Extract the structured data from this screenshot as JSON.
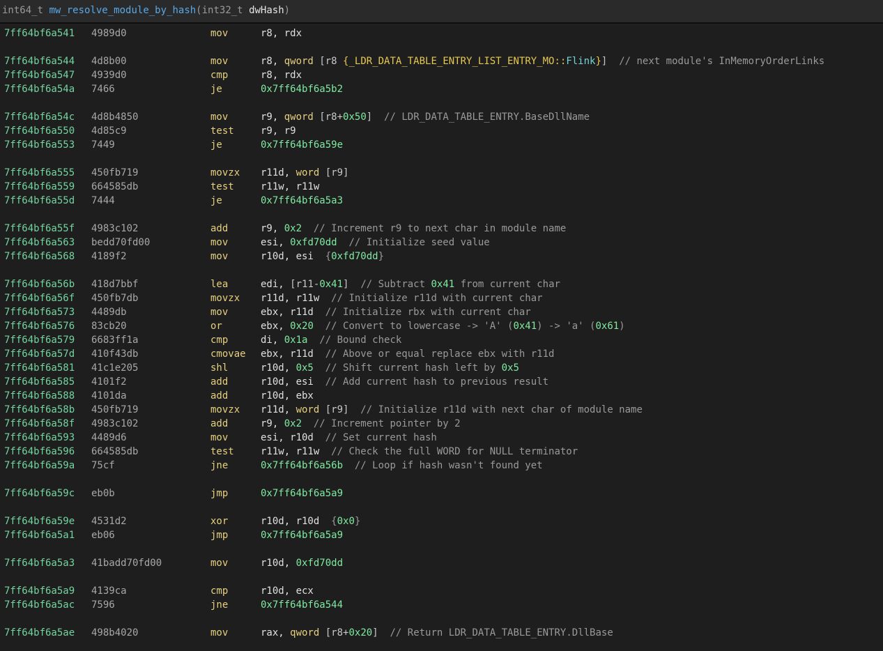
{
  "header": {
    "return_type": "int64_t",
    "function_name": "mw_resolve_module_by_hash",
    "param_type": "int32_t",
    "param_name": "dwHash",
    "open_paren": "(",
    "close_paren": ")"
  },
  "instructions": [
    {
      "addr": "7ff64bf6a541",
      "bytes": "4989d0",
      "mnem": "mov",
      "ops": [
        {
          "t": "reg",
          "v": "r8, rdx"
        }
      ]
    },
    {
      "addr": "7ff64bf6a544",
      "bytes": "4d8b00",
      "mnem": "mov",
      "ops": [
        {
          "t": "reg",
          "v": "r8, "
        },
        {
          "t": "kw",
          "v": "qword"
        },
        {
          "t": "brk",
          "v": " [r8 "
        },
        {
          "t": "fld",
          "v": "{_LDR_DATA_TABLE_ENTRY_LIST_ENTRY_MO::"
        },
        {
          "t": "fld2",
          "v": "Flink"
        },
        {
          "t": "fld",
          "v": "}"
        },
        {
          "t": "brk",
          "v": "]"
        },
        {
          "t": "cmt",
          "v": "  // next module's InMemoryOrderLinks"
        }
      ]
    },
    {
      "addr": "7ff64bf6a547",
      "bytes": "4939d0",
      "mnem": "cmp",
      "ops": [
        {
          "t": "reg",
          "v": "r8, rdx"
        }
      ]
    },
    {
      "addr": "7ff64bf6a54a",
      "bytes": "7466",
      "mnem": "je",
      "ops": [
        {
          "t": "num",
          "v": "0x7ff64bf6a5b2"
        }
      ]
    },
    {
      "addr": "7ff64bf6a54c",
      "bytes": "4d8b4850",
      "mnem": "mov",
      "ops": [
        {
          "t": "reg",
          "v": "r9, "
        },
        {
          "t": "kw",
          "v": "qword"
        },
        {
          "t": "brk",
          "v": " [r8+"
        },
        {
          "t": "num",
          "v": "0x50"
        },
        {
          "t": "brk",
          "v": "]"
        },
        {
          "t": "cmt",
          "v": "  // LDR_DATA_TABLE_ENTRY.BaseDllName"
        }
      ]
    },
    {
      "addr": "7ff64bf6a550",
      "bytes": "4d85c9",
      "mnem": "test",
      "ops": [
        {
          "t": "reg",
          "v": "r9, r9"
        }
      ]
    },
    {
      "addr": "7ff64bf6a553",
      "bytes": "7449",
      "mnem": "je",
      "ops": [
        {
          "t": "num",
          "v": "0x7ff64bf6a59e"
        }
      ]
    },
    {
      "addr": "7ff64bf6a555",
      "bytes": "450fb719",
      "mnem": "movzx",
      "ops": [
        {
          "t": "reg",
          "v": "r11d, "
        },
        {
          "t": "kw",
          "v": "word"
        },
        {
          "t": "brk",
          "v": " [r9]"
        }
      ]
    },
    {
      "addr": "7ff64bf6a559",
      "bytes": "664585db",
      "mnem": "test",
      "ops": [
        {
          "t": "reg",
          "v": "r11w, r11w"
        }
      ]
    },
    {
      "addr": "7ff64bf6a55d",
      "bytes": "7444",
      "mnem": "je",
      "ops": [
        {
          "t": "num",
          "v": "0x7ff64bf6a5a3"
        }
      ]
    },
    {
      "addr": "7ff64bf6a55f",
      "bytes": "4983c102",
      "mnem": "add",
      "ops": [
        {
          "t": "reg",
          "v": "r9, "
        },
        {
          "t": "num",
          "v": "0x2"
        },
        {
          "t": "cmt",
          "v": "  // Increment r9 to next char in module name"
        }
      ]
    },
    {
      "addr": "7ff64bf6a563",
      "bytes": "bedd70fd00",
      "mnem": "mov",
      "ops": [
        {
          "t": "reg",
          "v": "esi, "
        },
        {
          "t": "num",
          "v": "0xfd70dd"
        },
        {
          "t": "cmt",
          "v": "  // Initialize seed value"
        }
      ]
    },
    {
      "addr": "7ff64bf6a568",
      "bytes": "4189f2",
      "mnem": "mov",
      "ops": [
        {
          "t": "reg",
          "v": "r10d, esi  "
        },
        {
          "t": "cmt",
          "v": "{"
        },
        {
          "t": "num",
          "v": "0xfd70dd"
        },
        {
          "t": "cmt",
          "v": "}"
        }
      ]
    },
    {
      "addr": "7ff64bf6a56b",
      "bytes": "418d7bbf",
      "mnem": "lea",
      "ops": [
        {
          "t": "reg",
          "v": "edi, "
        },
        {
          "t": "brk",
          "v": "[r11-"
        },
        {
          "t": "num",
          "v": "0x41"
        },
        {
          "t": "brk",
          "v": "]"
        },
        {
          "t": "cmt",
          "v": "  // Subtract "
        },
        {
          "t": "num",
          "v": "0x41"
        },
        {
          "t": "cmt",
          "v": " from current char"
        }
      ]
    },
    {
      "addr": "7ff64bf6a56f",
      "bytes": "450fb7db",
      "mnem": "movzx",
      "ops": [
        {
          "t": "reg",
          "v": "r11d, r11w"
        },
        {
          "t": "cmt",
          "v": "  // Initialize r11d with current char"
        }
      ]
    },
    {
      "addr": "7ff64bf6a573",
      "bytes": "4489db",
      "mnem": "mov",
      "ops": [
        {
          "t": "reg",
          "v": "ebx, r11d"
        },
        {
          "t": "cmt",
          "v": "  // Initialize rbx with current char"
        }
      ]
    },
    {
      "addr": "7ff64bf6a576",
      "bytes": "83cb20",
      "mnem": "or",
      "ops": [
        {
          "t": "reg",
          "v": "ebx, "
        },
        {
          "t": "num",
          "v": "0x20"
        },
        {
          "t": "cmt",
          "v": "  // Convert to lowercase -> 'A' ("
        },
        {
          "t": "num",
          "v": "0x41"
        },
        {
          "t": "cmt",
          "v": ") -> 'a' ("
        },
        {
          "t": "num",
          "v": "0x61"
        },
        {
          "t": "cmt",
          "v": ")"
        }
      ]
    },
    {
      "addr": "7ff64bf6a579",
      "bytes": "6683ff1a",
      "mnem": "cmp",
      "ops": [
        {
          "t": "reg",
          "v": "di, "
        },
        {
          "t": "num",
          "v": "0x1a"
        },
        {
          "t": "cmt",
          "v": "  // Bound check"
        }
      ]
    },
    {
      "addr": "7ff64bf6a57d",
      "bytes": "410f43db",
      "mnem": "cmovae",
      "ops": [
        {
          "t": "reg",
          "v": "ebx, r11d"
        },
        {
          "t": "cmt",
          "v": "  // Above or equal replace ebx with r11d"
        }
      ]
    },
    {
      "addr": "7ff64bf6a581",
      "bytes": "41c1e205",
      "mnem": "shl",
      "ops": [
        {
          "t": "reg",
          "v": "r10d, "
        },
        {
          "t": "num",
          "v": "0x5"
        },
        {
          "t": "cmt",
          "v": "  // Shift current hash left by "
        },
        {
          "t": "num",
          "v": "0x5"
        }
      ]
    },
    {
      "addr": "7ff64bf6a585",
      "bytes": "4101f2",
      "mnem": "add",
      "ops": [
        {
          "t": "reg",
          "v": "r10d, esi"
        },
        {
          "t": "cmt",
          "v": "  // Add current hash to previous result"
        }
      ]
    },
    {
      "addr": "7ff64bf6a588",
      "bytes": "4101da",
      "mnem": "add",
      "ops": [
        {
          "t": "reg",
          "v": "r10d, ebx"
        }
      ]
    },
    {
      "addr": "7ff64bf6a58b",
      "bytes": "450fb719",
      "mnem": "movzx",
      "ops": [
        {
          "t": "reg",
          "v": "r11d, "
        },
        {
          "t": "kw",
          "v": "word"
        },
        {
          "t": "brk",
          "v": " [r9]"
        },
        {
          "t": "cmt",
          "v": "  // Initialize r11d with next char of module name"
        }
      ]
    },
    {
      "addr": "7ff64bf6a58f",
      "bytes": "4983c102",
      "mnem": "add",
      "ops": [
        {
          "t": "reg",
          "v": "r9, "
        },
        {
          "t": "num",
          "v": "0x2"
        },
        {
          "t": "cmt",
          "v": "  // Increment pointer by 2"
        }
      ]
    },
    {
      "addr": "7ff64bf6a593",
      "bytes": "4489d6",
      "mnem": "mov",
      "ops": [
        {
          "t": "reg",
          "v": "esi, r10d"
        },
        {
          "t": "cmt",
          "v": "  // Set current hash"
        }
      ]
    },
    {
      "addr": "7ff64bf6a596",
      "bytes": "664585db",
      "mnem": "test",
      "ops": [
        {
          "t": "reg",
          "v": "r11w, r11w"
        },
        {
          "t": "cmt",
          "v": "  // Check the full WORD for NULL terminator"
        }
      ]
    },
    {
      "addr": "7ff64bf6a59a",
      "bytes": "75cf",
      "mnem": "jne",
      "ops": [
        {
          "t": "num",
          "v": "0x7ff64bf6a56b"
        },
        {
          "t": "cmt",
          "v": "  // Loop if hash wasn't found yet"
        }
      ]
    },
    {
      "addr": "7ff64bf6a59c",
      "bytes": "eb0b",
      "mnem": "jmp",
      "ops": [
        {
          "t": "num",
          "v": "0x7ff64bf6a5a9"
        }
      ]
    },
    {
      "addr": "7ff64bf6a59e",
      "bytes": "4531d2",
      "mnem": "xor",
      "ops": [
        {
          "t": "reg",
          "v": "r10d, r10d  "
        },
        {
          "t": "cmt",
          "v": "{"
        },
        {
          "t": "num",
          "v": "0x0"
        },
        {
          "t": "cmt",
          "v": "}"
        }
      ]
    },
    {
      "addr": "7ff64bf6a5a1",
      "bytes": "eb06",
      "mnem": "jmp",
      "ops": [
        {
          "t": "num",
          "v": "0x7ff64bf6a5a9"
        }
      ]
    },
    {
      "addr": "7ff64bf6a5a3",
      "bytes": "41badd70fd00",
      "mnem": "mov",
      "ops": [
        {
          "t": "reg",
          "v": "r10d, "
        },
        {
          "t": "num",
          "v": "0xfd70dd"
        }
      ]
    },
    {
      "addr": "7ff64bf6a5a9",
      "bytes": "4139ca",
      "mnem": "cmp",
      "ops": [
        {
          "t": "reg",
          "v": "r10d, ecx"
        }
      ]
    },
    {
      "addr": "7ff64bf6a5ac",
      "bytes": "7596",
      "mnem": "jne",
      "ops": [
        {
          "t": "num",
          "v": "0x7ff64bf6a544"
        }
      ]
    },
    {
      "addr": "7ff64bf6a5ae",
      "bytes": "498b4020",
      "mnem": "mov",
      "ops": [
        {
          "t": "reg",
          "v": "rax, "
        },
        {
          "t": "kw",
          "v": "qword"
        },
        {
          "t": "brk",
          "v": " [r8+"
        },
        {
          "t": "num",
          "v": "0x20"
        },
        {
          "t": "brk",
          "v": "]"
        },
        {
          "t": "cmt",
          "v": "  // Return LDR_DATA_TABLE_ENTRY.DllBase"
        }
      ]
    }
  ]
}
